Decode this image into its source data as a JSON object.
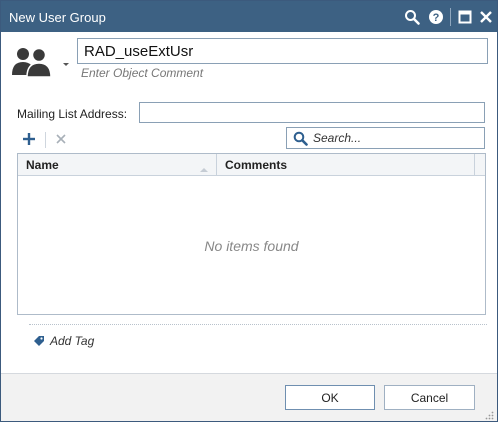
{
  "window": {
    "title": "New User Group",
    "controls": [
      "search-icon",
      "help-icon",
      "maximize-icon",
      "close-icon"
    ]
  },
  "object": {
    "name": "RAD_useExtUsr",
    "comment_placeholder": "Enter Object Comment",
    "icon": "user-group-icon"
  },
  "mailing_list": {
    "label": "Mailing List Address:",
    "value": ""
  },
  "toolbar": {
    "add_icon": "plus-icon",
    "remove_icon": "x-icon",
    "search_placeholder": "Search..."
  },
  "grid": {
    "columns": [
      "Name",
      "Comments"
    ],
    "rows": [],
    "empty_message": "No items found"
  },
  "tags": {
    "add_label": "Add Tag",
    "icon": "tag-icon"
  },
  "footer": {
    "ok_label": "OK",
    "cancel_label": "Cancel"
  },
  "colors": {
    "titlebar": "#3d6183",
    "accent": "#2e5f8f",
    "border": "#8aa0b5"
  }
}
